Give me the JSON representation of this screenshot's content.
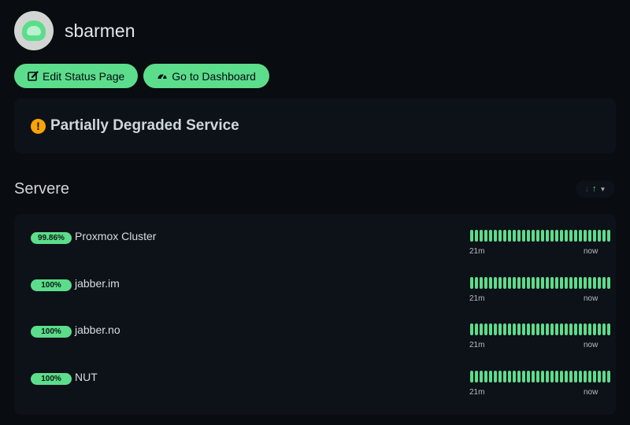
{
  "header": {
    "title": "sbarmen",
    "avatar_icon": "uptime-kuma-logo-icon"
  },
  "buttons": {
    "edit_label": "Edit Status Page",
    "edit_icon": "edit-icon",
    "dashboard_label": "Go to Dashboard",
    "dashboard_icon": "speedometer-icon"
  },
  "status": {
    "icon": "exclamation-circle-icon",
    "text": "Partially Degraded Service",
    "icon_color": "#f8a306"
  },
  "group": {
    "title": "Servere",
    "sort_down": "↓",
    "sort_up": "↑",
    "sort_caret": "▼",
    "monitors": [
      {
        "uptime": "99.86%",
        "name": "Proxmox Cluster",
        "bars": 30,
        "time_left": "21m",
        "time_right": "now"
      },
      {
        "uptime": "100%",
        "name": "jabber.im",
        "bars": 30,
        "time_left": "21m",
        "time_right": "now"
      },
      {
        "uptime": "100%",
        "name": "jabber.no",
        "bars": 30,
        "time_left": "21m",
        "time_right": "now"
      },
      {
        "uptime": "100%",
        "name": "NUT",
        "bars": 30,
        "time_left": "21m",
        "time_right": "now"
      }
    ]
  },
  "colors": {
    "accent": "#5cdd8b",
    "background": "#090c10",
    "card": "#0d1118",
    "warning": "#f8a306"
  }
}
